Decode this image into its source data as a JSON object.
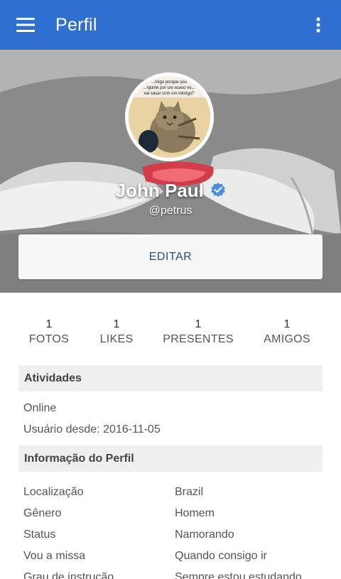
{
  "appbar": {
    "title": "Perfil",
    "color": "#2f6fd0"
  },
  "profile": {
    "name": "John Paul",
    "handle": "@petrus",
    "avatar_caption": "...migo porque sou ...rgunte por um acaso vo... vai casar com um inimigo?",
    "edit_label": "EDITAR"
  },
  "stats": [
    {
      "value": "1",
      "label": "FOTOS"
    },
    {
      "value": "1",
      "label": "LIKES"
    },
    {
      "value": "1",
      "label": "PRESENTES"
    },
    {
      "value": "1",
      "label": "AMIGOS"
    }
  ],
  "activities": {
    "title": "Atividades",
    "status": "Online",
    "member_since": "Usuário desde: 2016-11-05"
  },
  "profile_info": {
    "title": "Informação do Perfil",
    "rows": [
      {
        "key": "Localização",
        "value": "Brazil"
      },
      {
        "key": "Gênero",
        "value": "Homem"
      },
      {
        "key": "Status",
        "value": "Namorando"
      },
      {
        "key": "Vou a missa",
        "value": "Quando consigo ir"
      },
      {
        "key": "Grau de instrução",
        "value": "Sempre estou estudando"
      }
    ]
  },
  "icons": {
    "menu": "hamburger-menu-icon",
    "more": "more-vertical-icon",
    "verified": "verified-badge-icon"
  }
}
